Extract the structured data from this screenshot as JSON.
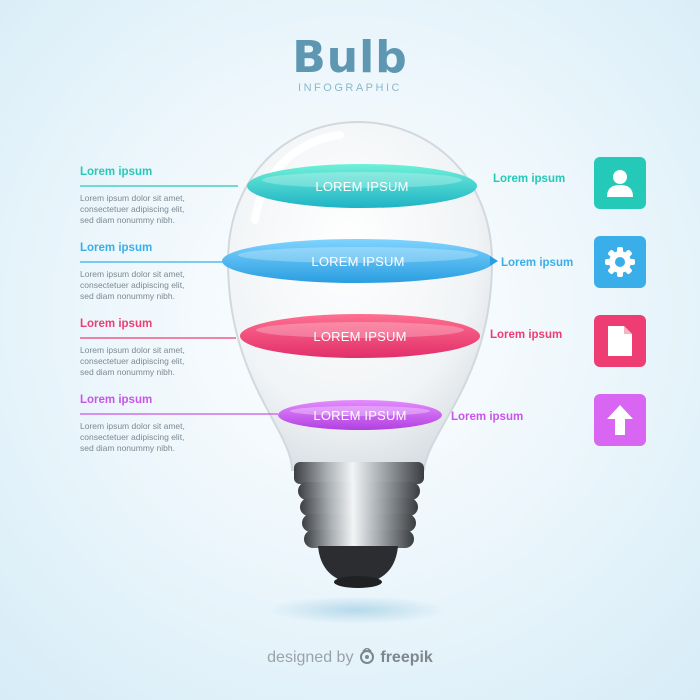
{
  "header": {
    "title": "Bulb",
    "subtitle": "INFOGRAPHIC"
  },
  "colors": {
    "teal": "#25c9b7",
    "blue": "#3aaee9",
    "pink": "#ee3d72",
    "purple": "#c955e8"
  },
  "steps": [
    {
      "band_label": "LOREM IPSUM",
      "left_title": "Lorem ipsum",
      "left_body": [
        "Lorem ipsum dolor sit amet,",
        "consectetuer adipiscing elit,",
        "sed diam nonummy nibh."
      ],
      "right_label": "Lorem ipsum",
      "icon": "user-icon",
      "color": "#25c9b7"
    },
    {
      "band_label": "LOREM IPSUM",
      "left_title": "Lorem ipsum",
      "left_body": [
        "Lorem ipsum dolor sit amet,",
        "consectetuer adipiscing elit,",
        "sed diam nonummy nibh."
      ],
      "right_label": "Lorem ipsum",
      "icon": "gear-icon",
      "color": "#3aaee9"
    },
    {
      "band_label": "LOREM IPSUM",
      "left_title": "Lorem ipsum",
      "left_body": [
        "Lorem ipsum dolor sit amet,",
        "consectetuer adipiscing elit,",
        "sed diam nonummy nibh."
      ],
      "right_label": "Lorem ipsum",
      "icon": "document-icon",
      "color": "#ee3d72"
    },
    {
      "band_label": "LOREM IPSUM",
      "left_title": "Lorem ipsum",
      "left_body": [
        "Lorem ipsum dolor sit amet,",
        "consectetuer adipiscing elit,",
        "sed diam nonummy nibh."
      ],
      "right_label": "Lorem ipsum",
      "icon": "arrow-up-icon",
      "color": "#c955e8"
    }
  ],
  "footer": {
    "credit_prefix": "designed by",
    "brand_icon": "freepik-logo-icon",
    "credit_brand": "freepik"
  }
}
